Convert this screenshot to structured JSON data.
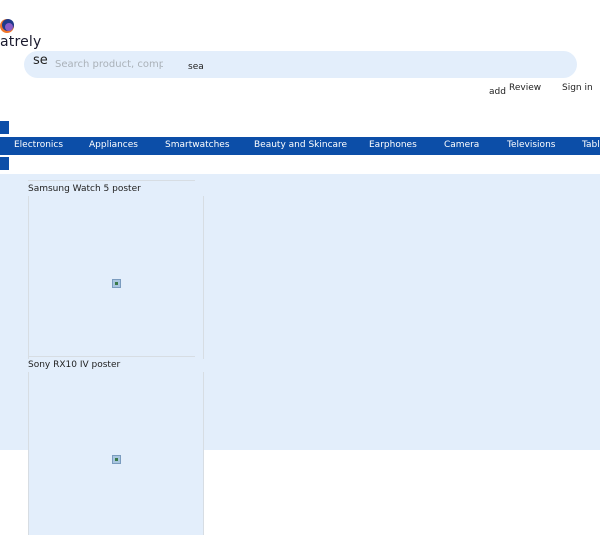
{
  "brand": {
    "name": "atrely",
    "colors": {
      "logo_orange": "#f0762a",
      "logo_blue": "#1f3a8a",
      "logo_purple": "#8a5cc8"
    }
  },
  "search": {
    "prefix": "se",
    "placeholder": "Search product, compa",
    "label": "sea"
  },
  "header": {
    "add_text": "add",
    "review_label": "Review",
    "signin_label": "Sign in"
  },
  "nav": {
    "items": [
      "Electronics",
      "Appliances",
      "Smartwatches",
      "Beauty and Skincare",
      "Earphones",
      "Camera",
      "Televisions",
      "Table"
    ]
  },
  "products": [
    {
      "title": "Samsung Watch 5 poster",
      "icon": "broken-image-icon"
    },
    {
      "title": "Sony RX10 IV poster",
      "icon": "broken-image-icon"
    }
  ],
  "theme": {
    "accent": "#0c4ea8",
    "light_bg": "#e3eefb"
  }
}
